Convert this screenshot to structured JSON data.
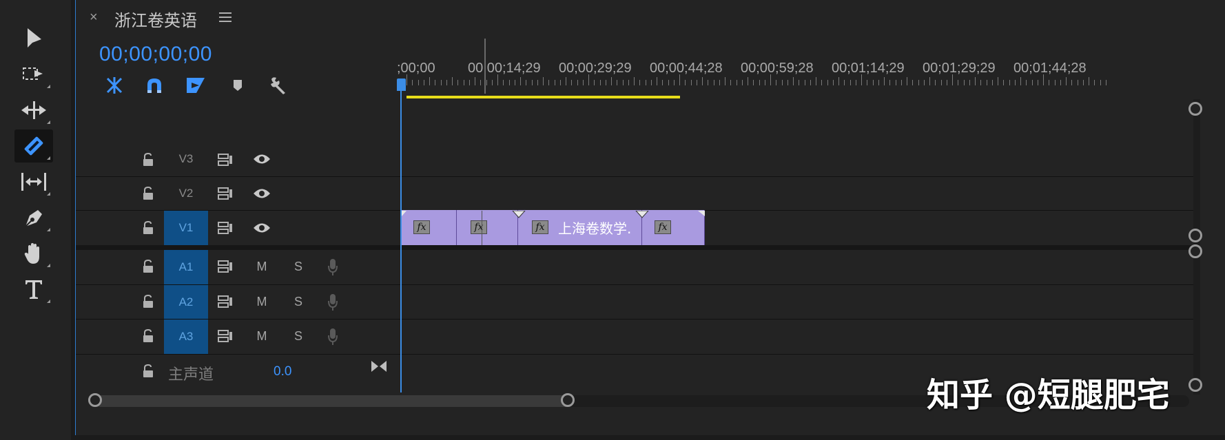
{
  "sequence": {
    "title": "浙江卷英语",
    "timecode": "00;00;00;00"
  },
  "controls": {
    "icons": [
      "nest-sequence-icon",
      "snap-magnet-icon",
      "linked-selection-icon",
      "add-marker-icon",
      "timeline-settings-wrench-icon"
    ]
  },
  "tools": [
    "selection-tool-icon",
    "track-select-tool-icon",
    "ripple-edit-tool-icon",
    "razor-tool-icon",
    "slip-tool-icon",
    "pen-tool-icon",
    "hand-tool-icon",
    "type-tool-icon"
  ],
  "ruler": {
    "labels": [
      ";00;00",
      "00;00;14;29",
      "00;00;29;29",
      "00;00;44;28",
      "00;00;59;28",
      "00;01;14;29",
      "00;01;29;29",
      "00;01;44;28"
    ]
  },
  "tracks": {
    "video": [
      {
        "name": "V3",
        "targeted": false
      },
      {
        "name": "V2",
        "targeted": false
      },
      {
        "name": "V1",
        "targeted": true
      }
    ],
    "audio": [
      {
        "name": "A1",
        "mute": "M",
        "solo": "S"
      },
      {
        "name": "A2",
        "mute": "M",
        "solo": "S"
      },
      {
        "name": "A3",
        "mute": "M",
        "solo": "S"
      }
    ],
    "master": {
      "label": "主声道",
      "value": "0.0"
    }
  },
  "clips": [
    {
      "fx": "fx",
      "name": ""
    },
    {
      "fx": "fx",
      "name": ""
    },
    {
      "fx": "fx",
      "name": "上海卷数学."
    },
    {
      "fx": "fx",
      "name": ""
    }
  ],
  "watermark": "知乎 @短腿肥宅",
  "colors": {
    "accent": "#3d94ff",
    "clip": "#a99ae0",
    "work_area": "#e6dc1a",
    "track_target": "#0f4f87"
  }
}
